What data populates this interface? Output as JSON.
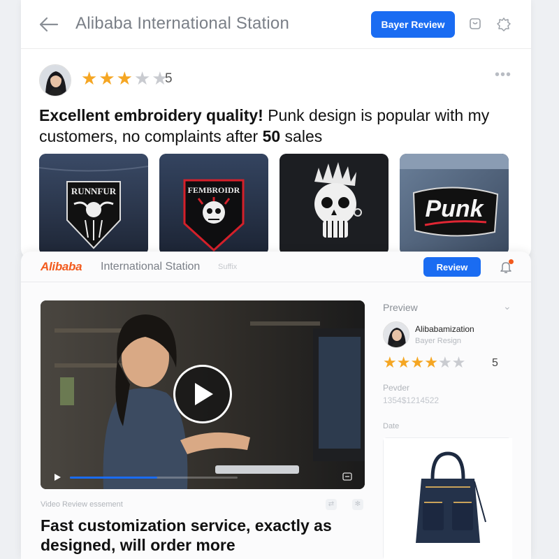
{
  "card1": {
    "title": "Alibaba International Station",
    "button_label": "Bayer Review",
    "icons": [
      "back-arrow-icon",
      "bag-icon",
      "settings-icon",
      "more-icon"
    ],
    "rating": {
      "stars": 3,
      "max": 5,
      "label": "5"
    },
    "review_parts": [
      {
        "text": "Excellent embroidery quality!",
        "bold": true
      },
      {
        "text": " Punk design is popular with my customers, no complaints after ",
        "bold": false
      },
      {
        "text": "50",
        "bold": true
      },
      {
        "text": " sales",
        "bold": false
      }
    ],
    "thumbnails": [
      {
        "patch_text": "RUNNFUR"
      },
      {
        "patch_text": "FEMBROIDR"
      },
      {
        "patch_text": ""
      },
      {
        "patch_text": "Punk"
      }
    ]
  },
  "card2": {
    "logo": "Alibaba",
    "title": "International Station",
    "faint_text": "Suffix",
    "button_label": "Review",
    "video": {
      "progress": 0.52
    },
    "video_caption": "Video Review essement",
    "review": "Fast customization service, exactly as designed, will order more",
    "side": {
      "title": "Preview",
      "name": "Alibabamization",
      "subtitle": "Bayer Resign",
      "rating": {
        "stars": 4,
        "max": 6,
        "label": "5"
      },
      "label1": "Pevder",
      "value1": "1354$1214522",
      "label2": "Date"
    }
  },
  "colors": {
    "accent": "#1a6cf2",
    "brand": "#f25a1d",
    "star": "#f5a623"
  }
}
